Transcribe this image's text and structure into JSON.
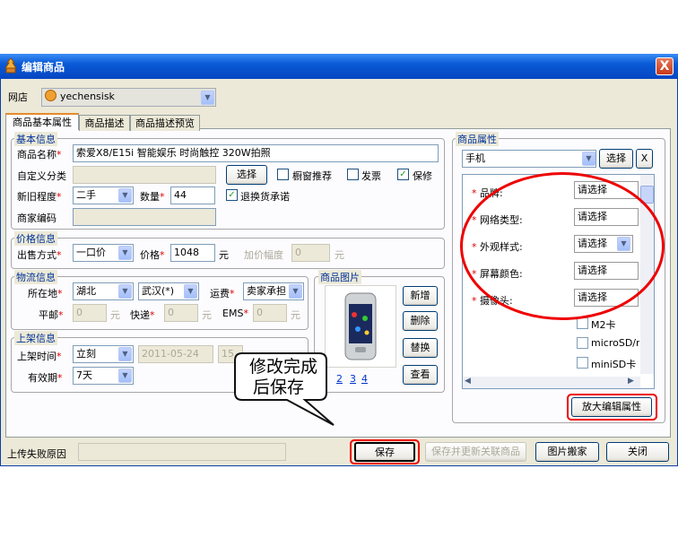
{
  "window": {
    "title": "编辑商品",
    "close_label": "X"
  },
  "shop": {
    "label": "网店",
    "value": "yechensisk"
  },
  "tabs": [
    {
      "label": "商品基本属性"
    },
    {
      "label": "商品描述"
    },
    {
      "label": "商品描述预览"
    }
  ],
  "basic": {
    "legend": "基本信息",
    "name_label": "商品名称",
    "name_value": "索爱X8/E15i 智能娱乐 时尚触控 320W拍照",
    "category_label": "自定义分类",
    "select_button": "选择",
    "showcase_label": "橱窗推荐",
    "invoice_label": "发票",
    "warranty_label": "保修",
    "condition_label": "新旧程度",
    "condition_value": "二手",
    "qty_label": "数量",
    "qty_value": "44",
    "return_label": "退换货承诺",
    "code_label": "商家编码"
  },
  "price": {
    "legend": "价格信息",
    "method_label": "出售方式",
    "method_value": "一口价",
    "price_label": "价格",
    "price_value": "1048",
    "unit": "元",
    "increment_label": "加价幅度",
    "increment_value": "0",
    "increment_unit": "元"
  },
  "logistics": {
    "legend": "物流信息",
    "location_label": "所在地",
    "province": "湖北",
    "city": "武汉(*)",
    "freight_label": "运费",
    "freight_value": "卖家承担",
    "mail_label": "平邮",
    "mail_value": "0",
    "express_label": "快递",
    "express_value": "0",
    "ems_label": "EMS",
    "ems_value": "0",
    "unit": "元"
  },
  "listing": {
    "legend": "上架信息",
    "time_label": "上架时间",
    "time_value": "立刻",
    "date_value": "2011-05-24",
    "hour_value": "15",
    "validity_label": "有效期",
    "validity_value": "7天"
  },
  "images": {
    "legend": "商品图片",
    "add": "新增",
    "delete": "删除",
    "replace": "替换",
    "view": "查看",
    "pages": [
      "2",
      "3",
      "4"
    ]
  },
  "props": {
    "legend": "商品属性",
    "category": "手机",
    "select_button": "选择",
    "clear": "X",
    "rows": [
      {
        "label": "品牌:",
        "value": "请选择"
      },
      {
        "label": "网络类型:",
        "value": "请选择"
      },
      {
        "label": "外观样式:",
        "value": "请选择"
      },
      {
        "label": "屏幕颜色:",
        "value": "请选择"
      },
      {
        "label": "摄像头:",
        "value": "请选择"
      }
    ],
    "options": [
      "M2卡",
      "microSD/mi",
      "miniSD卡"
    ],
    "enlarge_button": "放大编辑属性"
  },
  "callout": {
    "line1": "修改完成",
    "line2": "后保存"
  },
  "footer": {
    "fail_label": "上传失败原因",
    "save": "保存",
    "save_update": "保存并更新关联商品",
    "image_host": "图片搬家",
    "close": "关闭"
  },
  "colors": {
    "accent": "#0a5ad6",
    "highlight": "#e00000",
    "legend": "#003399"
  }
}
